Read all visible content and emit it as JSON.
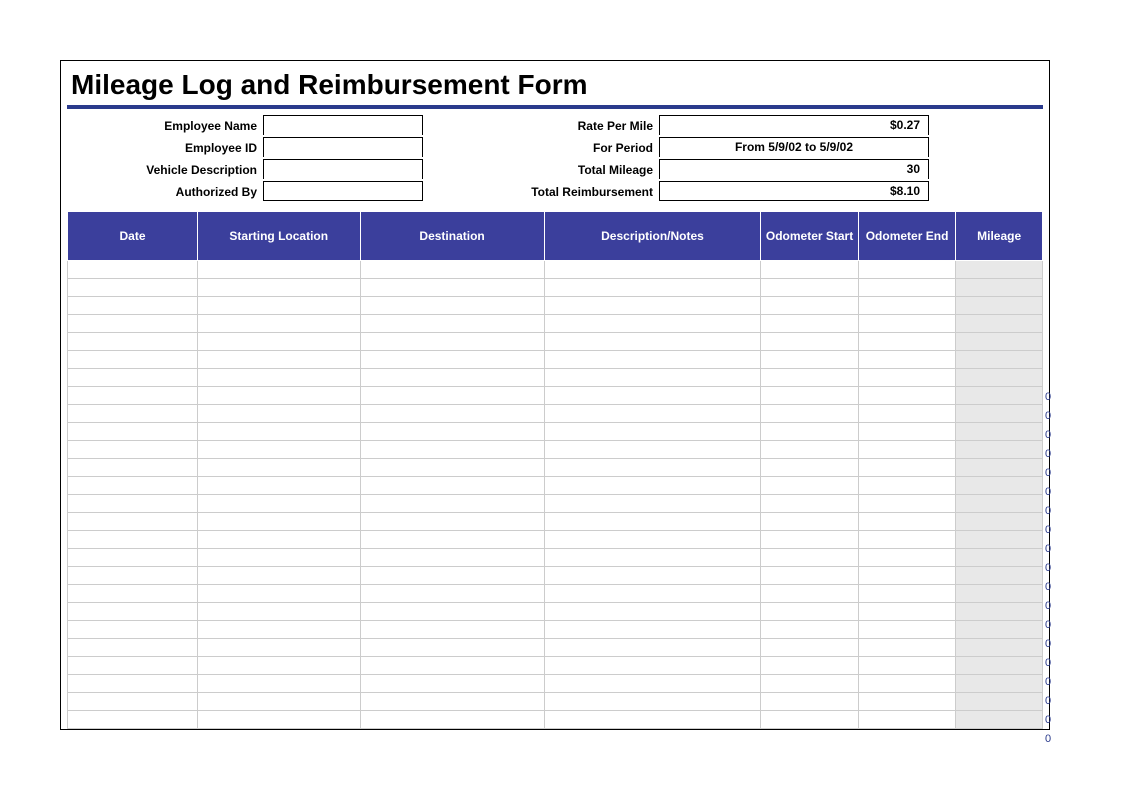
{
  "title": "Mileage Log and Reimbursement Form",
  "info": {
    "left": {
      "employee_name_label": "Employee Name",
      "employee_name_value": "",
      "employee_id_label": "Employee ID",
      "employee_id_value": "",
      "vehicle_desc_label": "Vehicle Description",
      "vehicle_desc_value": "",
      "authorized_by_label": "Authorized By",
      "authorized_by_value": ""
    },
    "right": {
      "rate_label": "Rate Per Mile",
      "rate_value": "$0.27",
      "period_label": "For Period",
      "period_value": "From 5/9/02 to 5/9/02",
      "total_mileage_label": "Total Mileage",
      "total_mileage_value": "30",
      "total_reimb_label": "Total Reimbursement",
      "total_reimb_value": "$8.10"
    }
  },
  "columns": {
    "date": "Date",
    "start": "Starting Location",
    "dest": "Destination",
    "desc": "Description/Notes",
    "ostart": "Odometer Start",
    "oend": "Odometer End",
    "mileage": "Mileage"
  },
  "rows": [
    {
      "mileage": ""
    },
    {
      "mileage": ""
    },
    {
      "mileage": ""
    },
    {
      "mileage": ""
    },
    {
      "mileage": ""
    },
    {
      "mileage": ""
    },
    {
      "mileage": ""
    },
    {
      "mileage": "0"
    },
    {
      "mileage": "0"
    },
    {
      "mileage": "0"
    },
    {
      "mileage": "0"
    },
    {
      "mileage": "0"
    },
    {
      "mileage": "0"
    },
    {
      "mileage": "0"
    },
    {
      "mileage": "0"
    },
    {
      "mileage": "0"
    },
    {
      "mileage": "0"
    },
    {
      "mileage": "0"
    },
    {
      "mileage": "0"
    },
    {
      "mileage": "0"
    },
    {
      "mileage": "0"
    },
    {
      "mileage": "0"
    },
    {
      "mileage": "0"
    },
    {
      "mileage": "0"
    },
    {
      "mileage": "0"
    },
    {
      "mileage": "0"
    }
  ]
}
